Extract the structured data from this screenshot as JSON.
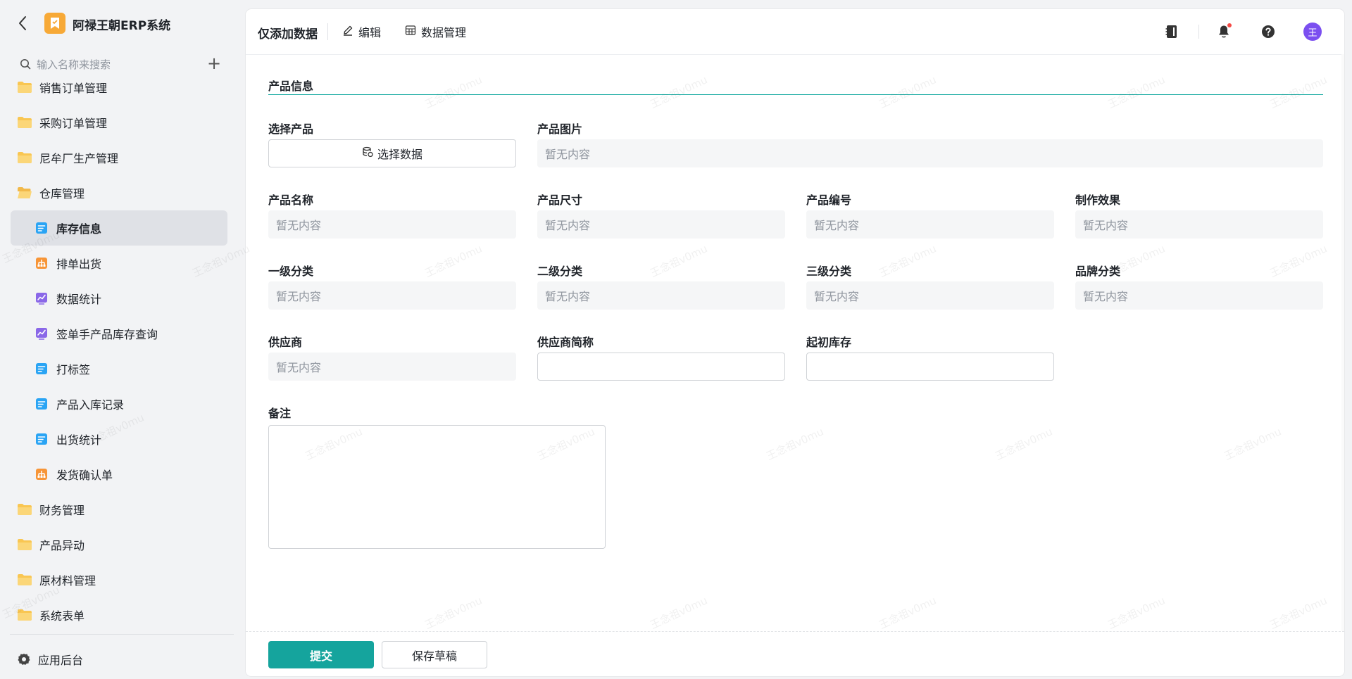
{
  "app": {
    "title": "阿禄王朝ERP系统",
    "logo_color": "#f7a937"
  },
  "search": {
    "placeholder": "输入名称来搜索"
  },
  "sidebar": {
    "items": [
      {
        "label": "销售订单管理",
        "type": "group",
        "icon": "folder-icon"
      },
      {
        "label": "采购订单管理",
        "type": "group",
        "icon": "folder-icon"
      },
      {
        "label": "尼牟厂生产管理",
        "type": "group",
        "icon": "folder-icon"
      },
      {
        "label": "仓库管理",
        "type": "group",
        "icon": "folder-open-icon"
      },
      {
        "label": "库存信息",
        "type": "child",
        "icon": "form-icon",
        "active": true
      },
      {
        "label": "排单出货",
        "type": "child",
        "icon": "flow-icon"
      },
      {
        "label": "数据统计",
        "type": "child",
        "icon": "chart-icon"
      },
      {
        "label": "签单手产品库存查询",
        "type": "child",
        "icon": "chart-icon"
      },
      {
        "label": "打标签",
        "type": "child",
        "icon": "form-icon"
      },
      {
        "label": "产品入库记录",
        "type": "child",
        "icon": "form-icon"
      },
      {
        "label": "出货统计",
        "type": "child",
        "icon": "form-icon"
      },
      {
        "label": "发货确认单",
        "type": "child",
        "icon": "flow-icon"
      },
      {
        "label": "财务管理",
        "type": "group",
        "icon": "folder-icon"
      },
      {
        "label": "产品异动",
        "type": "group",
        "icon": "folder-icon"
      },
      {
        "label": "原材料管理",
        "type": "group",
        "icon": "folder-icon"
      },
      {
        "label": "系统表单",
        "type": "group",
        "icon": "folder-icon"
      }
    ],
    "admin_label": "应用后台"
  },
  "toolbar": {
    "mode_title": "仅添加数据",
    "edit_label": "编辑",
    "data_manage_label": "数据管理",
    "avatar_text": "王"
  },
  "form": {
    "section_title": "产品信息",
    "empty_text": "暂无内容",
    "labels": {
      "select_product": "选择产品",
      "product_image": "产品图片",
      "product_name": "产品名称",
      "product_size": "产品尺寸",
      "product_code": "产品编号",
      "production_effect": "制作效果",
      "category_1": "一级分类",
      "category_2": "二级分类",
      "category_3": "三级分类",
      "brand_category": "品牌分类",
      "supplier": "供应商",
      "supplier_short": "供应商简称",
      "initial_stock": "起初库存",
      "remark": "备注"
    },
    "select_data_button": "选择数据",
    "supplier_short_value": "",
    "initial_stock_value": "",
    "remark_value": ""
  },
  "footer": {
    "submit_label": "提交",
    "draft_label": "保存草稿"
  },
  "colors": {
    "accent": "#15a49d",
    "active_item_bg": "#dfe1e6",
    "avatar_bg": "#7b4ff0"
  },
  "watermark": "王念祖v0mu"
}
